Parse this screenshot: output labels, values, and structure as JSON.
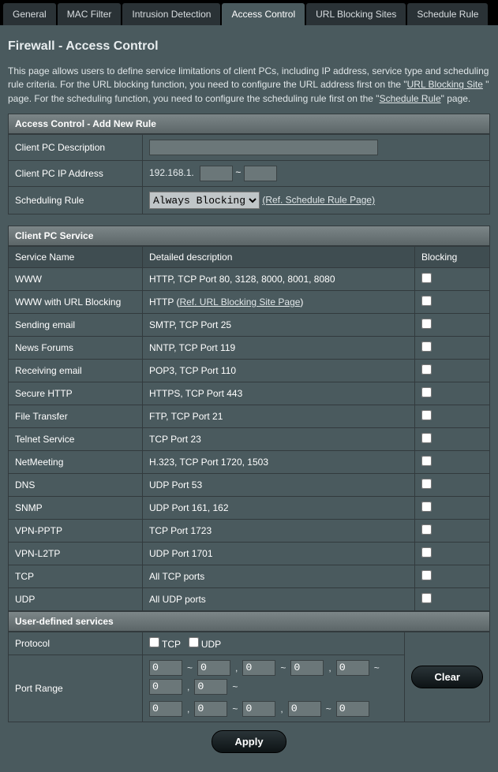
{
  "tabs": [
    "General",
    "MAC Filter",
    "Intrusion Detection",
    "Access Control",
    "URL Blocking Sites",
    "Schedule Rule"
  ],
  "active_tab": 3,
  "page_title": "Firewall - Access Control",
  "intro_part1": "This page allows users to define service limitations of client PCs, including IP address, service type and scheduling rule criteria. For the URL blocking function, you need to configure the URL address first on the \"",
  "intro_link1": "URL Blocking Site",
  "intro_part2": " \" page. For the scheduling function, you need to configure the scheduling rule first on the \"",
  "intro_link2": "Schedule Rule",
  "intro_part3": "\" page.",
  "section_add_rule": "Access Control - Add New Rule",
  "labels": {
    "client_desc": "Client PC Description",
    "client_ip": "Client PC IP Address",
    "sched_rule": "Scheduling Rule",
    "ip_prefix": "192.168.1.",
    "tilde": "~",
    "ref_schedule": "(Ref. Schedule Rule Page)"
  },
  "schedule_options": [
    "Always Blocking"
  ],
  "section_client_service": "Client PC Service",
  "headers": {
    "service": "Service Name",
    "detail": "Detailed description",
    "blocking": "Blocking"
  },
  "services": [
    {
      "name": "WWW",
      "detail": "HTTP, TCP Port 80, 3128, 8000, 8001, 8080"
    },
    {
      "name": "WWW with URL Blocking",
      "detail_prefix": "HTTP (",
      "detail_link": "Ref. URL Blocking Site Page",
      "detail_suffix": ")"
    },
    {
      "name": "Sending email",
      "detail": "SMTP, TCP Port 25"
    },
    {
      "name": "News Forums",
      "detail": "NNTP, TCP Port 119"
    },
    {
      "name": "Receiving email",
      "detail": "POP3, TCP Port 110"
    },
    {
      "name": "Secure HTTP",
      "detail": "HTTPS, TCP Port 443"
    },
    {
      "name": "File Transfer",
      "detail": "FTP, TCP Port 21"
    },
    {
      "name": "Telnet Service",
      "detail": "TCP Port 23"
    },
    {
      "name": "NetMeeting",
      "detail": "H.323, TCP Port 1720, 1503"
    },
    {
      "name": "DNS",
      "detail": "UDP Port 53"
    },
    {
      "name": "SNMP",
      "detail": "UDP Port 161, 162"
    },
    {
      "name": "VPN-PPTP",
      "detail": "TCP Port 1723"
    },
    {
      "name": "VPN-L2TP",
      "detail": "UDP Port 1701"
    },
    {
      "name": "TCP",
      "detail": "All TCP ports"
    },
    {
      "name": "UDP",
      "detail": "All UDP ports"
    }
  ],
  "section_userdef": "User-defined services",
  "userdef": {
    "protocol_label": "Protocol",
    "tcp_label": "TCP",
    "udp_label": "UDP",
    "port_range_label": "Port Range",
    "port_default": "0",
    "clear": "Clear",
    "comma": ","
  },
  "apply": "Apply"
}
